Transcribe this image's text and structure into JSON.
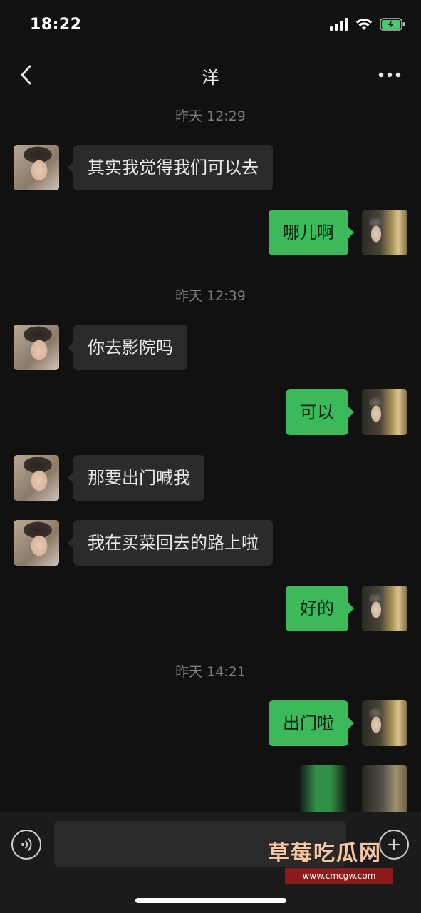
{
  "status_bar": {
    "time": "18:22",
    "icons": [
      "signal-icon",
      "wifi-icon",
      "battery-charging-icon"
    ],
    "battery_color": "#3cd070"
  },
  "header": {
    "title": "洋",
    "back_icon": "chevron-left-icon",
    "more_icon": "more-dots-icon"
  },
  "chat": {
    "timestamps": [
      "昨天 12:29",
      "昨天 12:39",
      "昨天 14:21"
    ],
    "messages": [
      {
        "side": "in",
        "text": "其实我觉得我们可以去"
      },
      {
        "side": "out",
        "text": "哪儿啊"
      },
      {
        "side": "in",
        "text": "你去影院吗"
      },
      {
        "side": "out",
        "text": "可以"
      },
      {
        "side": "in",
        "text": "那要出门喊我"
      },
      {
        "side": "in",
        "text": "我在买菜回去的路上啦"
      },
      {
        "side": "out",
        "text": "好的"
      },
      {
        "side": "out",
        "text": "出门啦"
      }
    ]
  },
  "input_bar": {
    "voice_icon": "voice-icon",
    "plus_icon": "plus-circle-icon",
    "value": ""
  },
  "watermark": {
    "text": "草莓吃瓜网",
    "url": "www.cmcgw.com"
  },
  "colors": {
    "background": "#111111",
    "incoming_bubble": "#2b2b2b",
    "outgoing_bubble": "#3cb95b",
    "timestamp": "#7d7d7d"
  }
}
